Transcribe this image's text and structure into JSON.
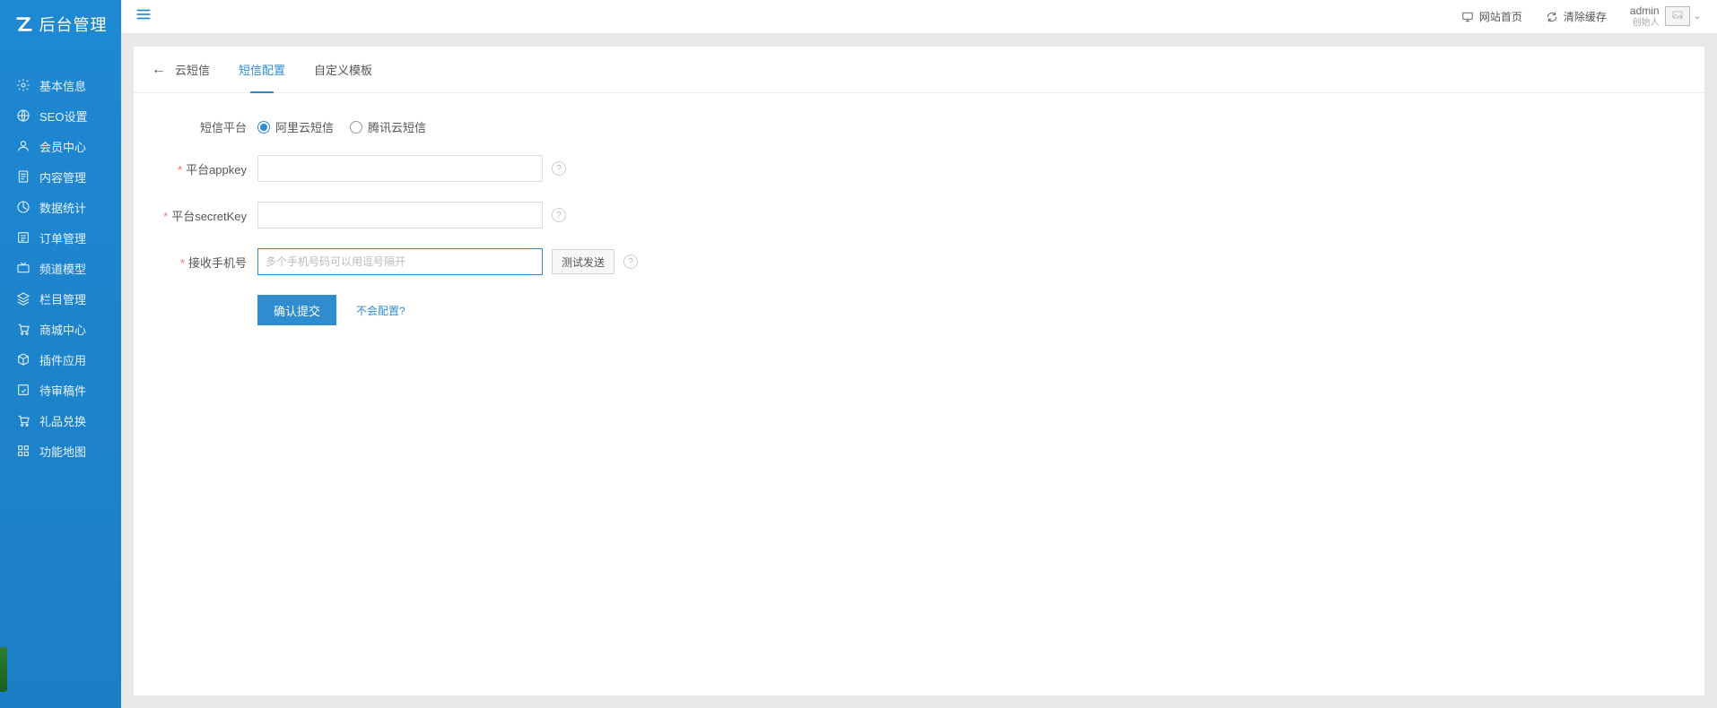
{
  "brand": {
    "text": "后台管理"
  },
  "sidebar": {
    "items": [
      {
        "label": "基本信息"
      },
      {
        "label": "SEO设置"
      },
      {
        "label": "会员中心"
      },
      {
        "label": "内容管理"
      },
      {
        "label": "数据统计"
      },
      {
        "label": "订单管理"
      },
      {
        "label": "频道模型"
      },
      {
        "label": "栏目管理"
      },
      {
        "label": "商城中心"
      },
      {
        "label": "插件应用"
      },
      {
        "label": "待审稿件"
      },
      {
        "label": "礼品兑换"
      },
      {
        "label": "功能地图"
      }
    ]
  },
  "topbar": {
    "home": "网站首页",
    "clear_cache": "清除缓存",
    "user": {
      "name": "admin",
      "role": "创始人"
    }
  },
  "tabs": {
    "breadcrumb": "云短信",
    "items": [
      {
        "label": "短信配置",
        "active": true
      },
      {
        "label": "自定义模板",
        "active": false
      }
    ]
  },
  "form": {
    "platform_label": "短信平台",
    "platform_options": [
      {
        "label": "阿里云短信",
        "checked": true
      },
      {
        "label": "腾讯云短信",
        "checked": false
      }
    ],
    "appkey_label": "平台appkey",
    "appkey_value": "",
    "secret_label": "平台secretKey",
    "secret_value": "",
    "phone_label": "接收手机号",
    "phone_placeholder": "多个手机号码可以用逗号隔开",
    "phone_value": "",
    "test_btn": "测试发送",
    "submit_btn": "确认提交",
    "help_link": "不会配置?"
  }
}
